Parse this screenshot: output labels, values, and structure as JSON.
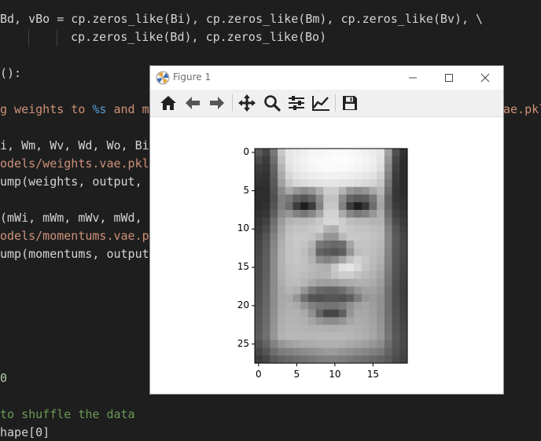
{
  "editor": {
    "lines": [
      {
        "top": 14,
        "left": 0,
        "tokens": [
          {
            "t": "Bd, vBo = cp.zeros_like(Bi), cp.zeros_like(Bm), cp.zeros_like(Bv), \\",
            "c": "default"
          }
        ]
      },
      {
        "top": 37,
        "left": 90,
        "tokens": [
          {
            "t": "cp.zeros_like(Bd), cp.zeros_like(Bo)",
            "c": "default"
          }
        ]
      },
      {
        "top": 83,
        "left": 0,
        "tokens": [
          {
            "t": "():",
            "c": "default"
          }
        ]
      },
      {
        "top": 129,
        "left": 0,
        "tokens": [
          {
            "t": "g weights to ",
            "c": "string"
          },
          {
            "t": "%s",
            "c": "kw"
          },
          {
            "t": " and m",
            "c": "string"
          }
        ]
      },
      {
        "top": 129,
        "left": 640,
        "tokens": [
          {
            "t": "ae.pkl",
            "c": "string"
          }
        ]
      },
      {
        "top": 175,
        "left": 0,
        "tokens": [
          {
            "t": "i, Wm, Wv, Wd, Wo, Bi",
            "c": "default"
          }
        ]
      },
      {
        "top": 198,
        "left": 0,
        "tokens": [
          {
            "t": "odels/weights.vae.pkl",
            "c": "string"
          }
        ]
      },
      {
        "top": 221,
        "left": 0,
        "tokens": [
          {
            "t": "ump(weights, output,",
            "c": "default"
          }
        ]
      },
      {
        "top": 267,
        "left": 0,
        "tokens": [
          {
            "t": "(mWi, mWm, mWv, mWd,",
            "c": "default"
          }
        ]
      },
      {
        "top": 290,
        "left": 0,
        "tokens": [
          {
            "t": "odels/momentums.vae.p",
            "c": "string"
          }
        ]
      },
      {
        "top": 313,
        "left": 0,
        "tokens": [
          {
            "t": "ump(momentums, output",
            "c": "default"
          }
        ]
      },
      {
        "top": 471,
        "left": 0,
        "tokens": [
          {
            "t": "0",
            "c": "number"
          }
        ]
      },
      {
        "top": 517,
        "left": 0,
        "tokens": [
          {
            "t": "to shuffle the data",
            "c": "comment"
          }
        ]
      },
      {
        "top": 540,
        "left": 0,
        "tokens": [
          {
            "t": "hape[0]",
            "c": "default"
          }
        ]
      }
    ]
  },
  "figure_window": {
    "title": "Figure 1",
    "buttons": {
      "minimize": "minimize-icon",
      "maximize": "maximize-icon",
      "close": "close-icon"
    },
    "toolbar": [
      "home-icon",
      "back-arrow-icon",
      "forward-arrow-icon",
      "pan-icon",
      "zoom-icon",
      "subplots-icon",
      "edit-axes-icon",
      "save-icon"
    ]
  },
  "chart_data": {
    "type": "heatmap",
    "colormap": "gray",
    "title": "",
    "xlabel": "",
    "ylabel": "",
    "xlim": [
      -0.5,
      19.5
    ],
    "ylim": [
      27.5,
      -0.5
    ],
    "xticks": [
      0,
      5,
      10,
      15
    ],
    "yticks": [
      0,
      5,
      10,
      15,
      20,
      25
    ],
    "grid": false,
    "values": [
      [
        90,
        70,
        120,
        200,
        230,
        235,
        240,
        245,
        245,
        248,
        250,
        250,
        248,
        245,
        240,
        235,
        230,
        160,
        80,
        50
      ],
      [
        75,
        60,
        110,
        190,
        230,
        238,
        242,
        248,
        250,
        250,
        252,
        252,
        250,
        248,
        244,
        238,
        228,
        150,
        70,
        45
      ],
      [
        60,
        55,
        100,
        180,
        225,
        235,
        240,
        245,
        248,
        250,
        250,
        250,
        248,
        245,
        240,
        235,
        222,
        140,
        65,
        45
      ],
      [
        55,
        50,
        95,
        170,
        215,
        228,
        232,
        236,
        240,
        242,
        242,
        240,
        238,
        236,
        232,
        226,
        210,
        130,
        60,
        45
      ],
      [
        50,
        48,
        90,
        160,
        200,
        215,
        220,
        225,
        228,
        230,
        230,
        228,
        225,
        222,
        218,
        212,
        200,
        120,
        58,
        45
      ],
      [
        45,
        45,
        85,
        140,
        170,
        150,
        140,
        150,
        175,
        205,
        205,
        180,
        150,
        140,
        148,
        168,
        185,
        110,
        55,
        45
      ],
      [
        45,
        45,
        80,
        130,
        120,
        95,
        85,
        100,
        140,
        195,
        195,
        140,
        100,
        90,
        95,
        120,
        170,
        100,
        55,
        48
      ],
      [
        45,
        50,
        85,
        130,
        110,
        60,
        30,
        60,
        130,
        200,
        200,
        130,
        60,
        30,
        55,
        110,
        165,
        100,
        60,
        50
      ],
      [
        50,
        55,
        95,
        140,
        150,
        130,
        120,
        135,
        165,
        210,
        210,
        170,
        135,
        120,
        130,
        150,
        175,
        110,
        65,
        55
      ],
      [
        55,
        65,
        110,
        155,
        180,
        185,
        185,
        190,
        200,
        215,
        215,
        205,
        190,
        185,
        185,
        180,
        180,
        120,
        75,
        60
      ],
      [
        60,
        75,
        120,
        165,
        190,
        195,
        195,
        200,
        205,
        180,
        175,
        205,
        200,
        195,
        195,
        190,
        185,
        130,
        85,
        65
      ],
      [
        65,
        85,
        130,
        170,
        195,
        200,
        200,
        195,
        180,
        150,
        150,
        185,
        200,
        200,
        198,
        195,
        188,
        135,
        90,
        70
      ],
      [
        70,
        90,
        135,
        175,
        195,
        200,
        195,
        180,
        120,
        110,
        105,
        110,
        165,
        195,
        195,
        192,
        185,
        135,
        90,
        72
      ],
      [
        72,
        92,
        138,
        178,
        195,
        198,
        190,
        170,
        100,
        90,
        85,
        95,
        150,
        190,
        194,
        190,
        182,
        132,
        88,
        72
      ],
      [
        74,
        94,
        140,
        178,
        195,
        198,
        192,
        178,
        140,
        130,
        140,
        165,
        195,
        210,
        200,
        188,
        178,
        128,
        86,
        70
      ],
      [
        75,
        95,
        140,
        178,
        192,
        196,
        192,
        186,
        180,
        175,
        200,
        225,
        230,
        215,
        196,
        185,
        172,
        125,
        84,
        68
      ],
      [
        76,
        96,
        140,
        176,
        190,
        192,
        188,
        182,
        178,
        180,
        195,
        205,
        205,
        195,
        186,
        178,
        165,
        120,
        82,
        66
      ],
      [
        78,
        98,
        140,
        174,
        186,
        188,
        182,
        170,
        160,
        158,
        160,
        168,
        172,
        176,
        176,
        170,
        158,
        116,
        80,
        64
      ],
      [
        80,
        100,
        140,
        170,
        180,
        175,
        150,
        120,
        105,
        100,
        100,
        110,
        130,
        150,
        162,
        162,
        150,
        112,
        78,
        62
      ],
      [
        82,
        102,
        140,
        168,
        170,
        150,
        110,
        85,
        80,
        85,
        85,
        82,
        95,
        125,
        150,
        155,
        145,
        110,
        78,
        62
      ],
      [
        84,
        104,
        142,
        170,
        175,
        170,
        150,
        130,
        120,
        115,
        115,
        125,
        145,
        160,
        165,
        158,
        145,
        110,
        80,
        64
      ],
      [
        86,
        106,
        144,
        172,
        178,
        178,
        170,
        145,
        100,
        70,
        70,
        95,
        150,
        168,
        168,
        160,
        146,
        112,
        82,
        66
      ],
      [
        88,
        108,
        146,
        174,
        180,
        180,
        176,
        165,
        150,
        140,
        140,
        150,
        165,
        172,
        170,
        162,
        148,
        114,
        84,
        68
      ],
      [
        90,
        110,
        148,
        176,
        182,
        182,
        180,
        178,
        178,
        176,
        176,
        178,
        178,
        176,
        172,
        164,
        150,
        116,
        86,
        70
      ],
      [
        92,
        112,
        150,
        178,
        184,
        184,
        184,
        184,
        184,
        184,
        184,
        184,
        182,
        178,
        174,
        166,
        152,
        118,
        88,
        72
      ],
      [
        80,
        100,
        130,
        150,
        160,
        165,
        170,
        172,
        175,
        176,
        176,
        174,
        170,
        165,
        158,
        150,
        140,
        110,
        86,
        72
      ],
      [
        70,
        85,
        110,
        125,
        130,
        135,
        140,
        145,
        150,
        155,
        155,
        150,
        145,
        140,
        135,
        128,
        120,
        100,
        82,
        70
      ],
      [
        60,
        70,
        90,
        100,
        105,
        110,
        115,
        120,
        125,
        128,
        128,
        125,
        120,
        115,
        110,
        105,
        100,
        90,
        76,
        66
      ]
    ]
  }
}
